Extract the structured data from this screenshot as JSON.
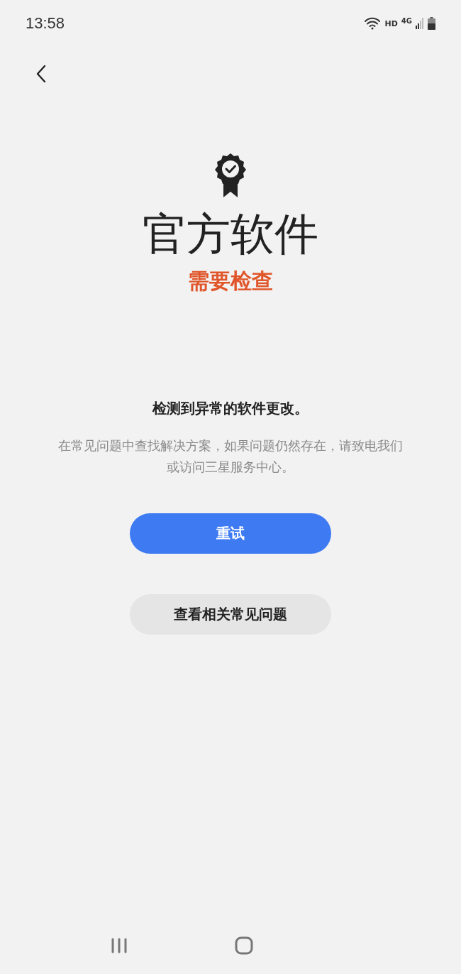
{
  "status_bar": {
    "time": "13:58",
    "hd": "HD",
    "network": "4G"
  },
  "title": "官方软件",
  "status": "需要检查",
  "heading": "检测到异常的软件更改。",
  "description": "在常见问题中查找解决方案，如果问题仍然存在，请致电我们或访问三星服务中心。",
  "buttons": [
    {
      "label": "重试",
      "kind": "primary"
    },
    {
      "label": "查看相关常见问题",
      "kind": "secondary"
    }
  ]
}
